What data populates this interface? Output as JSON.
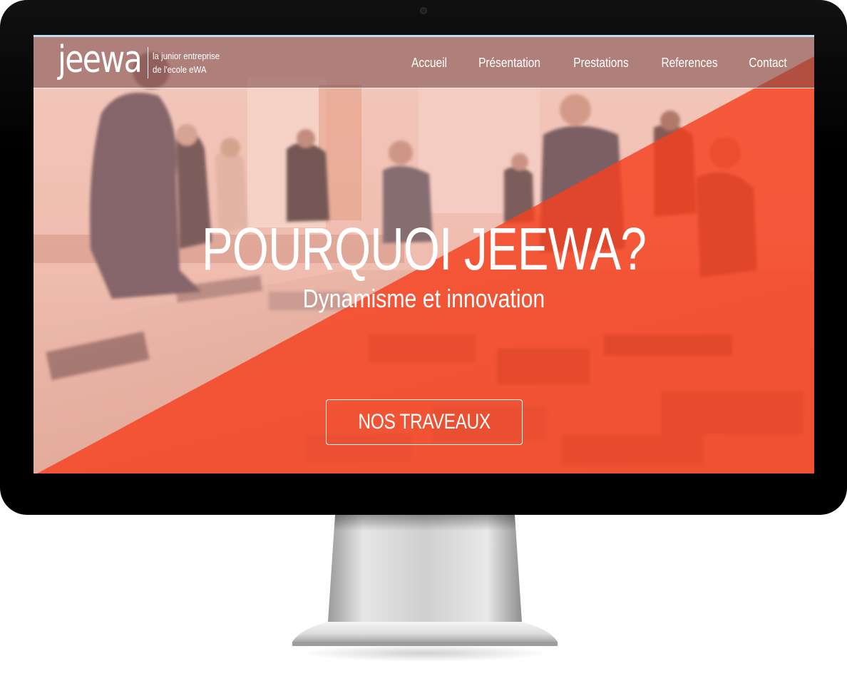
{
  "site": {
    "logo": {
      "wordmark": "jeewa",
      "tagline_line1": "la junior entreprise",
      "tagline_line2": "de l'ecole eWA"
    },
    "nav": {
      "items": [
        {
          "label": "Accueil"
        },
        {
          "label": "Présentation"
        },
        {
          "label": "Prestations"
        },
        {
          "label": "References"
        },
        {
          "label": "Contact"
        }
      ]
    },
    "hero": {
      "title": "POURQUOI JEEWA?",
      "subtitle": "Dynamisme et innovation",
      "cta_label": "NOS TRAVEAUX"
    }
  },
  "colors": {
    "accent": "#f5411e",
    "header_overlay": "#784646",
    "photo_tint": "#e8a79a"
  }
}
